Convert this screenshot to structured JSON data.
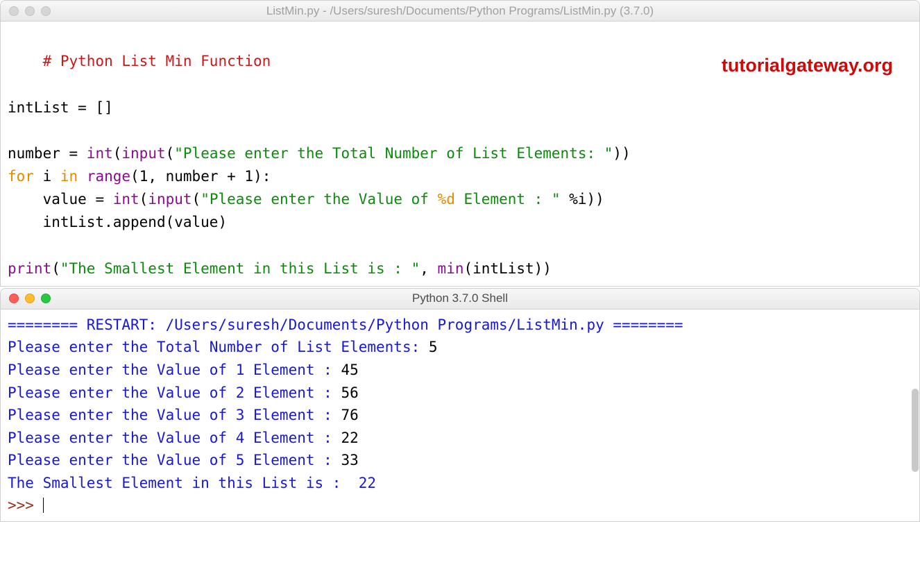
{
  "editor": {
    "title": "ListMin.py - /Users/suresh/Documents/Python Programs/ListMin.py (3.7.0)",
    "watermark": "tutorialgateway.org",
    "code": {
      "line1_comment": "# Python List Min Function",
      "l3": {
        "a": "intList",
        "b": " = []"
      },
      "l5": {
        "a": "number",
        "b": " = ",
        "c": "int",
        "d": "(",
        "e": "input",
        "f": "(",
        "g": "\"Please enter the Total Number of List Elements: \"",
        "h": "))"
      },
      "l6": {
        "a": "for ",
        "b": "i ",
        "c": "in ",
        "d": "range",
        "e": "(",
        "f": "1",
        "g": ", number + ",
        "h": "1",
        "i": "):"
      },
      "l7": {
        "indent": "    ",
        "a": "value",
        "b": " = ",
        "c": "int",
        "d": "(",
        "e": "input",
        "f": "(",
        "g": "\"Please enter the Value of ",
        "h": "%d",
        "i": " Element : \"",
        "j": " %i))"
      },
      "l8": {
        "indent": "    ",
        "a": "intList.append(value)"
      },
      "l10": {
        "a": "print",
        "b": "(",
        "c": "\"The Smallest Element in this List is : \"",
        "d": ", ",
        "e": "min",
        "f": "(intList))"
      }
    }
  },
  "shell": {
    "title": "Python 3.7.0 Shell",
    "restart_marker": "======== RESTART: /Users/suresh/Documents/Python Programs/ListMin.py ========",
    "out1_prompt": "Please enter the Total Number of List Elements: ",
    "out1_val": "5",
    "out2_prompt": "Please enter the Value of 1 Element : ",
    "out2_val": "45",
    "out3_prompt": "Please enter the Value of 2 Element : ",
    "out3_val": "56",
    "out4_prompt": "Please enter the Value of 3 Element : ",
    "out4_val": "76",
    "out5_prompt": "Please enter the Value of 4 Element : ",
    "out5_val": "22",
    "out6_prompt": "Please enter the Value of 5 Element : ",
    "out6_val": "33",
    "result": "The Smallest Element in this List is :  22",
    "prompt": ">>> "
  }
}
